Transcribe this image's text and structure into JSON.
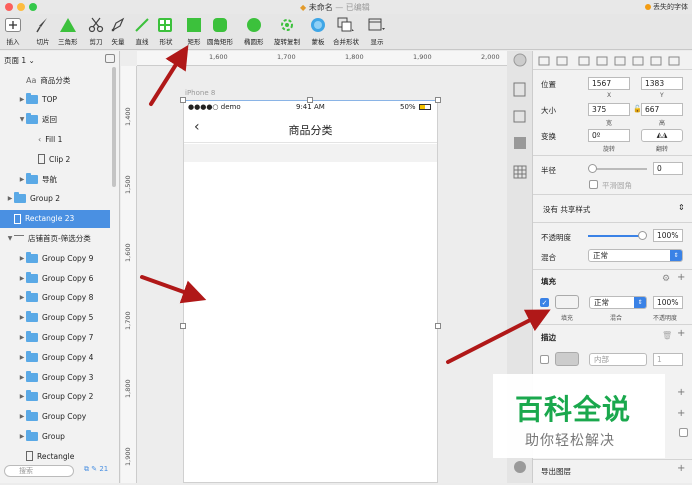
{
  "window": {
    "title": "未命名",
    "edited": "— 已编辑",
    "missing_fonts": "丢失的字体"
  },
  "toolbar": {
    "tools": [
      {
        "id": "insert",
        "label": "插入",
        "icon": "plus-icon"
      },
      {
        "id": "slice",
        "label": "切片",
        "icon": "slice-knife-icon"
      },
      {
        "id": "triangle",
        "label": "三角形",
        "icon": "triangle-icon"
      },
      {
        "id": "scissors",
        "label": "剪刀",
        "icon": "scissors-icon"
      },
      {
        "id": "vector",
        "label": "矢量",
        "icon": "pen-icon"
      },
      {
        "id": "line",
        "label": "直线",
        "icon": "line-icon"
      },
      {
        "id": "shape",
        "label": "形状",
        "icon": "shape-grid-icon"
      },
      {
        "id": "rect",
        "label": "矩形",
        "icon": "rectangle-icon"
      },
      {
        "id": "rounded",
        "label": "圆角矩形",
        "icon": "rounded-rect-icon"
      },
      {
        "id": "oval",
        "label": "椭圆形",
        "icon": "oval-icon"
      },
      {
        "id": "rotate_copy",
        "label": "旋转复制",
        "icon": "rotate-copy-icon"
      },
      {
        "id": "mask",
        "label": "蒙板",
        "icon": "mask-icon"
      },
      {
        "id": "combine",
        "label": "合并形状",
        "icon": "combine-icon"
      },
      {
        "id": "view",
        "label": "显示",
        "icon": "view-icon"
      }
    ]
  },
  "layers": {
    "page_selector": "页面 1",
    "items": [
      {
        "label": "商品分类",
        "type": "text",
        "indent": 1
      },
      {
        "label": "TOP",
        "type": "folder",
        "indent": 1,
        "arrow": "▶"
      },
      {
        "label": "返回",
        "type": "folder",
        "indent": 1,
        "arrow": "▼"
      },
      {
        "label": "Fill 1",
        "type": "path",
        "indent": 2
      },
      {
        "label": "Clip 2",
        "type": "rect",
        "indent": 2
      },
      {
        "label": "导航",
        "type": "folder",
        "indent": 1,
        "arrow": "▶"
      },
      {
        "label": "Group 2",
        "type": "folder",
        "indent": 0,
        "arrow": "▶"
      },
      {
        "label": "Rectangle 23",
        "type": "rect",
        "indent": 0,
        "selected": true
      },
      {
        "label": "店铺首页-筛选分类",
        "type": "artboard",
        "indent": 0,
        "arrow": "▼"
      },
      {
        "label": "Group Copy 9",
        "type": "folder",
        "indent": 1,
        "arrow": "▶"
      },
      {
        "label": "Group Copy 6",
        "type": "folder",
        "indent": 1,
        "arrow": "▶"
      },
      {
        "label": "Group Copy 8",
        "type": "folder",
        "indent": 1,
        "arrow": "▶"
      },
      {
        "label": "Group Copy 5",
        "type": "folder",
        "indent": 1,
        "arrow": "▶"
      },
      {
        "label": "Group Copy 7",
        "type": "folder",
        "indent": 1,
        "arrow": "▶"
      },
      {
        "label": "Group Copy 4",
        "type": "folder",
        "indent": 1,
        "arrow": "▶"
      },
      {
        "label": "Group Copy 3",
        "type": "folder",
        "indent": 1,
        "arrow": "▶"
      },
      {
        "label": "Group Copy 2",
        "type": "folder",
        "indent": 1,
        "arrow": "▶"
      },
      {
        "label": "Group Copy",
        "type": "folder",
        "indent": 1,
        "arrow": "▶"
      },
      {
        "label": "Group",
        "type": "folder",
        "indent": 1,
        "arrow": "▶"
      },
      {
        "label": "Rectangle",
        "type": "rect",
        "indent": 1
      }
    ],
    "search_placeholder": "搜索",
    "count": "21"
  },
  "canvas": {
    "ruler_top": [
      "1,600",
      "1,700",
      "1,800",
      "1,900",
      "2,000"
    ],
    "ruler_left": [
      "1,400",
      "1,500",
      "1,600",
      "1,700",
      "1,800",
      "1,900"
    ],
    "artboard_name": "iPhone 8",
    "status_carrier": "●●●●○ demo",
    "status_time": "9:41 AM",
    "status_battery": "50%",
    "nav_title": "商品分类"
  },
  "inspector": {
    "position_label": "位置",
    "x": "1567",
    "y": "1383",
    "x_label": "X",
    "y_label": "Y",
    "size_label": "大小",
    "width": "375",
    "height": "667",
    "width_label": "宽",
    "height_label": "高",
    "transform_label": "变换",
    "rotation": "0º",
    "rotate_label": "旋转",
    "flip_label": "翻转",
    "radius_label": "半径",
    "radius_value": "0",
    "smooth_corners": "平滑圆角",
    "shared_style": "没有 共享样式",
    "opacity_label": "不透明度",
    "opacity_value": "100%",
    "blend_label": "混合",
    "blend_value": "正常",
    "fill_title": "填充",
    "fill_blend": "正常",
    "fill_opacity": "100%",
    "fill_sub_fill": "填充",
    "fill_sub_blend": "混合",
    "fill_sub_opacity": "不透明度",
    "border_title": "描边",
    "border_position": "内部",
    "border_thickness": "1",
    "export_label": "导出图层"
  },
  "watermark": {
    "title": "百科全说",
    "subtitle": "助你轻松解决"
  },
  "colors": {
    "accent": "#3a82e6",
    "selection": "#4a90e2",
    "folder": "#5aa9e6",
    "tool_green": "#3cc13c",
    "arrow_red": "#b01818",
    "watermark_green": "#1aa84d"
  }
}
